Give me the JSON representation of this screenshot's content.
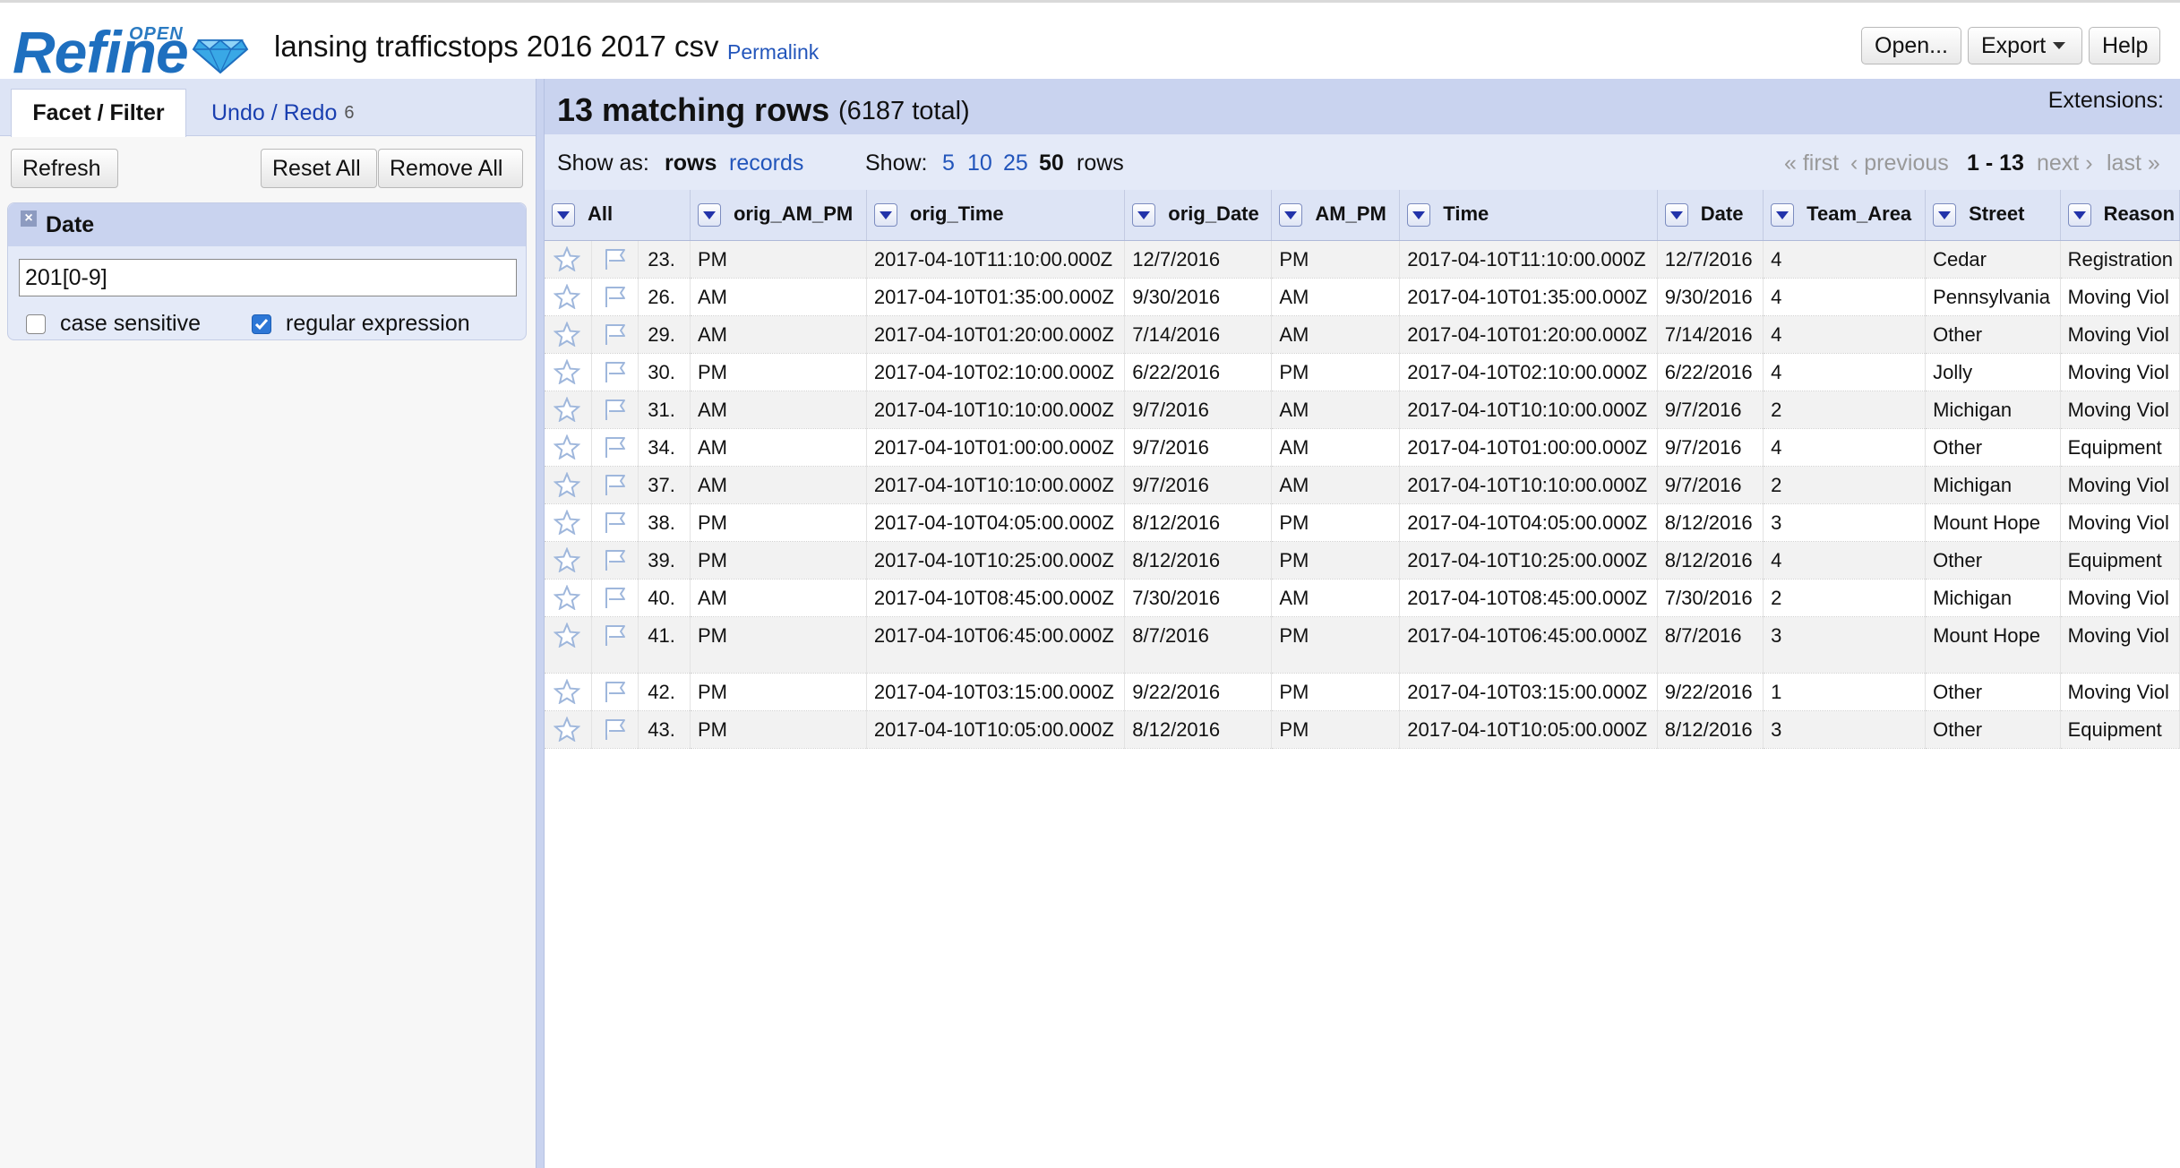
{
  "header": {
    "logo_open": "OPEN",
    "logo_refine": "Refine",
    "project_name": "lansing trafficstops 2016 2017 csv",
    "permalink": "Permalink",
    "buttons": {
      "open": "Open...",
      "export": "Export",
      "help": "Help"
    }
  },
  "left": {
    "tabs": {
      "facet": "Facet / Filter",
      "undo": "Undo / Redo",
      "undo_count": "6"
    },
    "buttons": {
      "refresh": "Refresh",
      "reset_all": "Reset All",
      "remove_all": "Remove All"
    },
    "facet": {
      "close": "×",
      "title": "Date",
      "value": "201[0-9]",
      "case_sensitive": "case sensitive",
      "regex": "regular expression",
      "case_checked": false,
      "regex_checked": true
    }
  },
  "summary": {
    "count": "13 matching rows",
    "total": "(6187 total)",
    "extensions": "Extensions:"
  },
  "view": {
    "show_as": "Show as:",
    "rows": "rows",
    "records": "records",
    "show": "Show:",
    "sizes": [
      "5",
      "10",
      "25",
      "50"
    ],
    "rows_suffix": "rows",
    "first": "« first",
    "previous": "‹ previous",
    "range": "1 - 13",
    "next": "next ›",
    "last": "last »"
  },
  "table": {
    "columns": [
      "All",
      "orig_AM_PM",
      "orig_Time",
      "orig_Date",
      "AM_PM",
      "Time",
      "Date",
      "Team_Area",
      "Street",
      "Reason"
    ],
    "rows": [
      [
        "23.",
        "PM",
        "2017-04-10T11:10:00.000Z",
        "12/7/2016",
        "PM",
        "2017-04-10T11:10:00.000Z",
        "12/7/2016",
        "4",
        "Cedar",
        "Registration"
      ],
      [
        "26.",
        "AM",
        "2017-04-10T01:35:00.000Z",
        "9/30/2016",
        "AM",
        "2017-04-10T01:35:00.000Z",
        "9/30/2016",
        "4",
        "Pennsylvania",
        "Moving Viol"
      ],
      [
        "29.",
        "AM",
        "2017-04-10T01:20:00.000Z",
        "7/14/2016",
        "AM",
        "2017-04-10T01:20:00.000Z",
        "7/14/2016",
        "4",
        "Other",
        "Moving Viol"
      ],
      [
        "30.",
        "PM",
        "2017-04-10T02:10:00.000Z",
        "6/22/2016",
        "PM",
        "2017-04-10T02:10:00.000Z",
        "6/22/2016",
        "4",
        "Jolly",
        "Moving Viol"
      ],
      [
        "31.",
        "AM",
        "2017-04-10T10:10:00.000Z",
        "9/7/2016",
        "AM",
        "2017-04-10T10:10:00.000Z",
        "9/7/2016",
        "2",
        "Michigan",
        "Moving Viol"
      ],
      [
        "34.",
        "AM",
        "2017-04-10T01:00:00.000Z",
        "9/7/2016",
        "AM",
        "2017-04-10T01:00:00.000Z",
        "9/7/2016",
        "4",
        "Other",
        "Equipment"
      ],
      [
        "37.",
        "AM",
        "2017-04-10T10:10:00.000Z",
        "9/7/2016",
        "AM",
        "2017-04-10T10:10:00.000Z",
        "9/7/2016",
        "2",
        "Michigan",
        "Moving Viol"
      ],
      [
        "38.",
        "PM",
        "2017-04-10T04:05:00.000Z",
        "8/12/2016",
        "PM",
        "2017-04-10T04:05:00.000Z",
        "8/12/2016",
        "3",
        "Mount Hope",
        "Moving Viol"
      ],
      [
        "39.",
        "PM",
        "2017-04-10T10:25:00.000Z",
        "8/12/2016",
        "PM",
        "2017-04-10T10:25:00.000Z",
        "8/12/2016",
        "4",
        "Other",
        "Equipment"
      ],
      [
        "40.",
        "AM",
        "2017-04-10T08:45:00.000Z",
        "7/30/2016",
        "AM",
        "2017-04-10T08:45:00.000Z",
        "7/30/2016",
        "2",
        "Michigan",
        "Moving Viol"
      ],
      [
        "41.",
        "PM",
        "2017-04-10T06:45:00.000Z",
        "8/7/2016",
        "PM",
        "2017-04-10T06:45:00.000Z",
        "8/7/2016",
        "3",
        "Mount Hope",
        "Moving Viol"
      ],
      [
        "42.",
        "PM",
        "2017-04-10T03:15:00.000Z",
        "9/22/2016",
        "PM",
        "2017-04-10T03:15:00.000Z",
        "9/22/2016",
        "1",
        "Other",
        "Moving Viol"
      ],
      [
        "43.",
        "PM",
        "2017-04-10T10:05:00.000Z",
        "8/12/2016",
        "PM",
        "2017-04-10T10:05:00.000Z",
        "8/12/2016",
        "3",
        "Other",
        "Equipment"
      ]
    ]
  },
  "colors": {
    "accent": "#c9d3ef",
    "link": "#2255bb",
    "logo": "#1e6fbf",
    "checkbox": "#2d77d6"
  },
  "icons": {
    "row_star": "star-icon",
    "row_flag": "flag-icon",
    "column_menu": "chevron-down-icon",
    "logo_gem": "diamond-icon"
  }
}
